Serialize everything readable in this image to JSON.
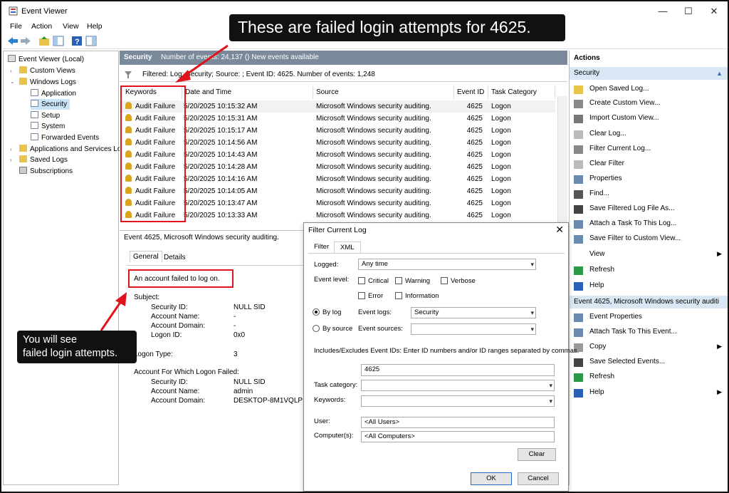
{
  "window": {
    "title": "Event Viewer",
    "minimize": "—",
    "maximize": "☐",
    "close": "✕"
  },
  "menu": [
    "File",
    "Action",
    "View",
    "Help"
  ],
  "tree": {
    "root": "Event Viewer (Local)",
    "custom_views": "Custom Views",
    "windows_logs": "Windows Logs",
    "application": "Application",
    "security": "Security",
    "setup": "Setup",
    "system": "System",
    "forwarded": "Forwarded Events",
    "apps_services": "Applications and Services Lo",
    "saved_logs": "Saved Logs",
    "subscriptions": "Subscriptions"
  },
  "center": {
    "header_title": "Security",
    "header_info": "Number of events: 24,137 () New events available",
    "filter_text": "Filtered: Log: Security; Source: ; Event ID: 4625. Number of events: 1,248",
    "columns": [
      "Keywords",
      "Date and Time",
      "Source",
      "Event ID",
      "Task Category"
    ],
    "rows": [
      [
        "Audit Failure",
        "5/20/2025 10:15:32 AM",
        "Microsoft Windows security auditing.",
        "4625",
        "Logon"
      ],
      [
        "Audit Failure",
        "5/20/2025 10:15:31 AM",
        "Microsoft Windows security auditing.",
        "4625",
        "Logon"
      ],
      [
        "Audit Failure",
        "5/20/2025 10:15:17 AM",
        "Microsoft Windows security auditing.",
        "4625",
        "Logon"
      ],
      [
        "Audit Failure",
        "5/20/2025 10:14:56 AM",
        "Microsoft Windows security auditing.",
        "4625",
        "Logon"
      ],
      [
        "Audit Failure",
        "5/20/2025 10:14:43 AM",
        "Microsoft Windows security auditing.",
        "4625",
        "Logon"
      ],
      [
        "Audit Failure",
        "5/20/2025 10:14:28 AM",
        "Microsoft Windows security auditing.",
        "4625",
        "Logon"
      ],
      [
        "Audit Failure",
        "5/20/2025 10:14:16 AM",
        "Microsoft Windows security auditing.",
        "4625",
        "Logon"
      ],
      [
        "Audit Failure",
        "5/20/2025 10:14:05 AM",
        "Microsoft Windows security auditing.",
        "4625",
        "Logon"
      ],
      [
        "Audit Failure",
        "5/20/2025 10:13:47 AM",
        "Microsoft Windows security auditing.",
        "4625",
        "Logon"
      ],
      [
        "Audit Failure",
        "5/20/2025 10:13:33 AM",
        "Microsoft Windows security auditing.",
        "4625",
        "Logon"
      ]
    ]
  },
  "detail": {
    "title": "Event 4625, Microsoft Windows security auditing.",
    "tab_general": "General",
    "tab_details": "Details",
    "message": "An account failed to log on.",
    "subject": "Subject:",
    "security_id_label": "Security ID:",
    "security_id": "NULL SID",
    "account_name_label": "Account Name:",
    "account_name": "-",
    "account_domain_label": "Account Domain:",
    "account_domain": "-",
    "logon_id_label": "Logon ID:",
    "logon_id": "0x0",
    "logon_type_label": "Logon Type:",
    "logon_type": "3",
    "failed_header": "Account For Which Logon Failed:",
    "f_security_id_label": "Security ID:",
    "f_security_id": "NULL SID",
    "f_account_name_label": "Account Name:",
    "f_account_name": "admin",
    "f_account_domain_label": "Account Domain:",
    "f_account_domain": "DESKTOP-8M1VQLP"
  },
  "actions": {
    "title": "Actions",
    "section1": "Security",
    "items1": [
      "Open Saved Log...",
      "Create Custom View...",
      "Import Custom View...",
      "Clear Log...",
      "Filter Current Log...",
      "Clear Filter",
      "Properties",
      "Find...",
      "Save Filtered Log File As...",
      "Attach a Task To This Log...",
      "Save Filter to Custom View...",
      "View",
      "Refresh",
      "Help"
    ],
    "section2": "Event 4625, Microsoft Windows security auditi",
    "items2": [
      "Event Properties",
      "Attach Task To This Event...",
      "Copy",
      "Save Selected Events...",
      "Refresh",
      "Help"
    ]
  },
  "dialog": {
    "title": "Filter Current Log",
    "tab_filter": "Filter",
    "tab_xml": "XML",
    "logged_label": "Logged:",
    "logged_value": "Any time",
    "event_level_label": "Event level:",
    "critical": "Critical",
    "warning": "Warning",
    "verbose": "Verbose",
    "error": "Error",
    "information": "Information",
    "by_log": "By log",
    "by_source": "By source",
    "event_logs_label": "Event logs:",
    "event_logs_value": "Security",
    "event_sources_label": "Event sources:",
    "includes_text": "Includes/Excludes Event IDs: Enter ID numbers and/or ID ranges separated by commas.",
    "event_id_value": "4625",
    "task_category_label": "Task category:",
    "keywords_label": "Keywords:",
    "user_label": "User:",
    "user_value": "<All Users>",
    "computer_label": "Computer(s):",
    "computer_value": "<All Computers>",
    "clear_button": "Clear",
    "ok_button": "OK",
    "cancel_button": "Cancel"
  },
  "annotations": {
    "top_callout": "These are failed login attempts for 4625.",
    "left_callout_line1": "You will see",
    "left_callout_line2": "failed login attempts."
  },
  "colors": {
    "annotation_red": "#e0141c",
    "header_gray": "#7a8a9a",
    "selection": "#cce4f7"
  }
}
